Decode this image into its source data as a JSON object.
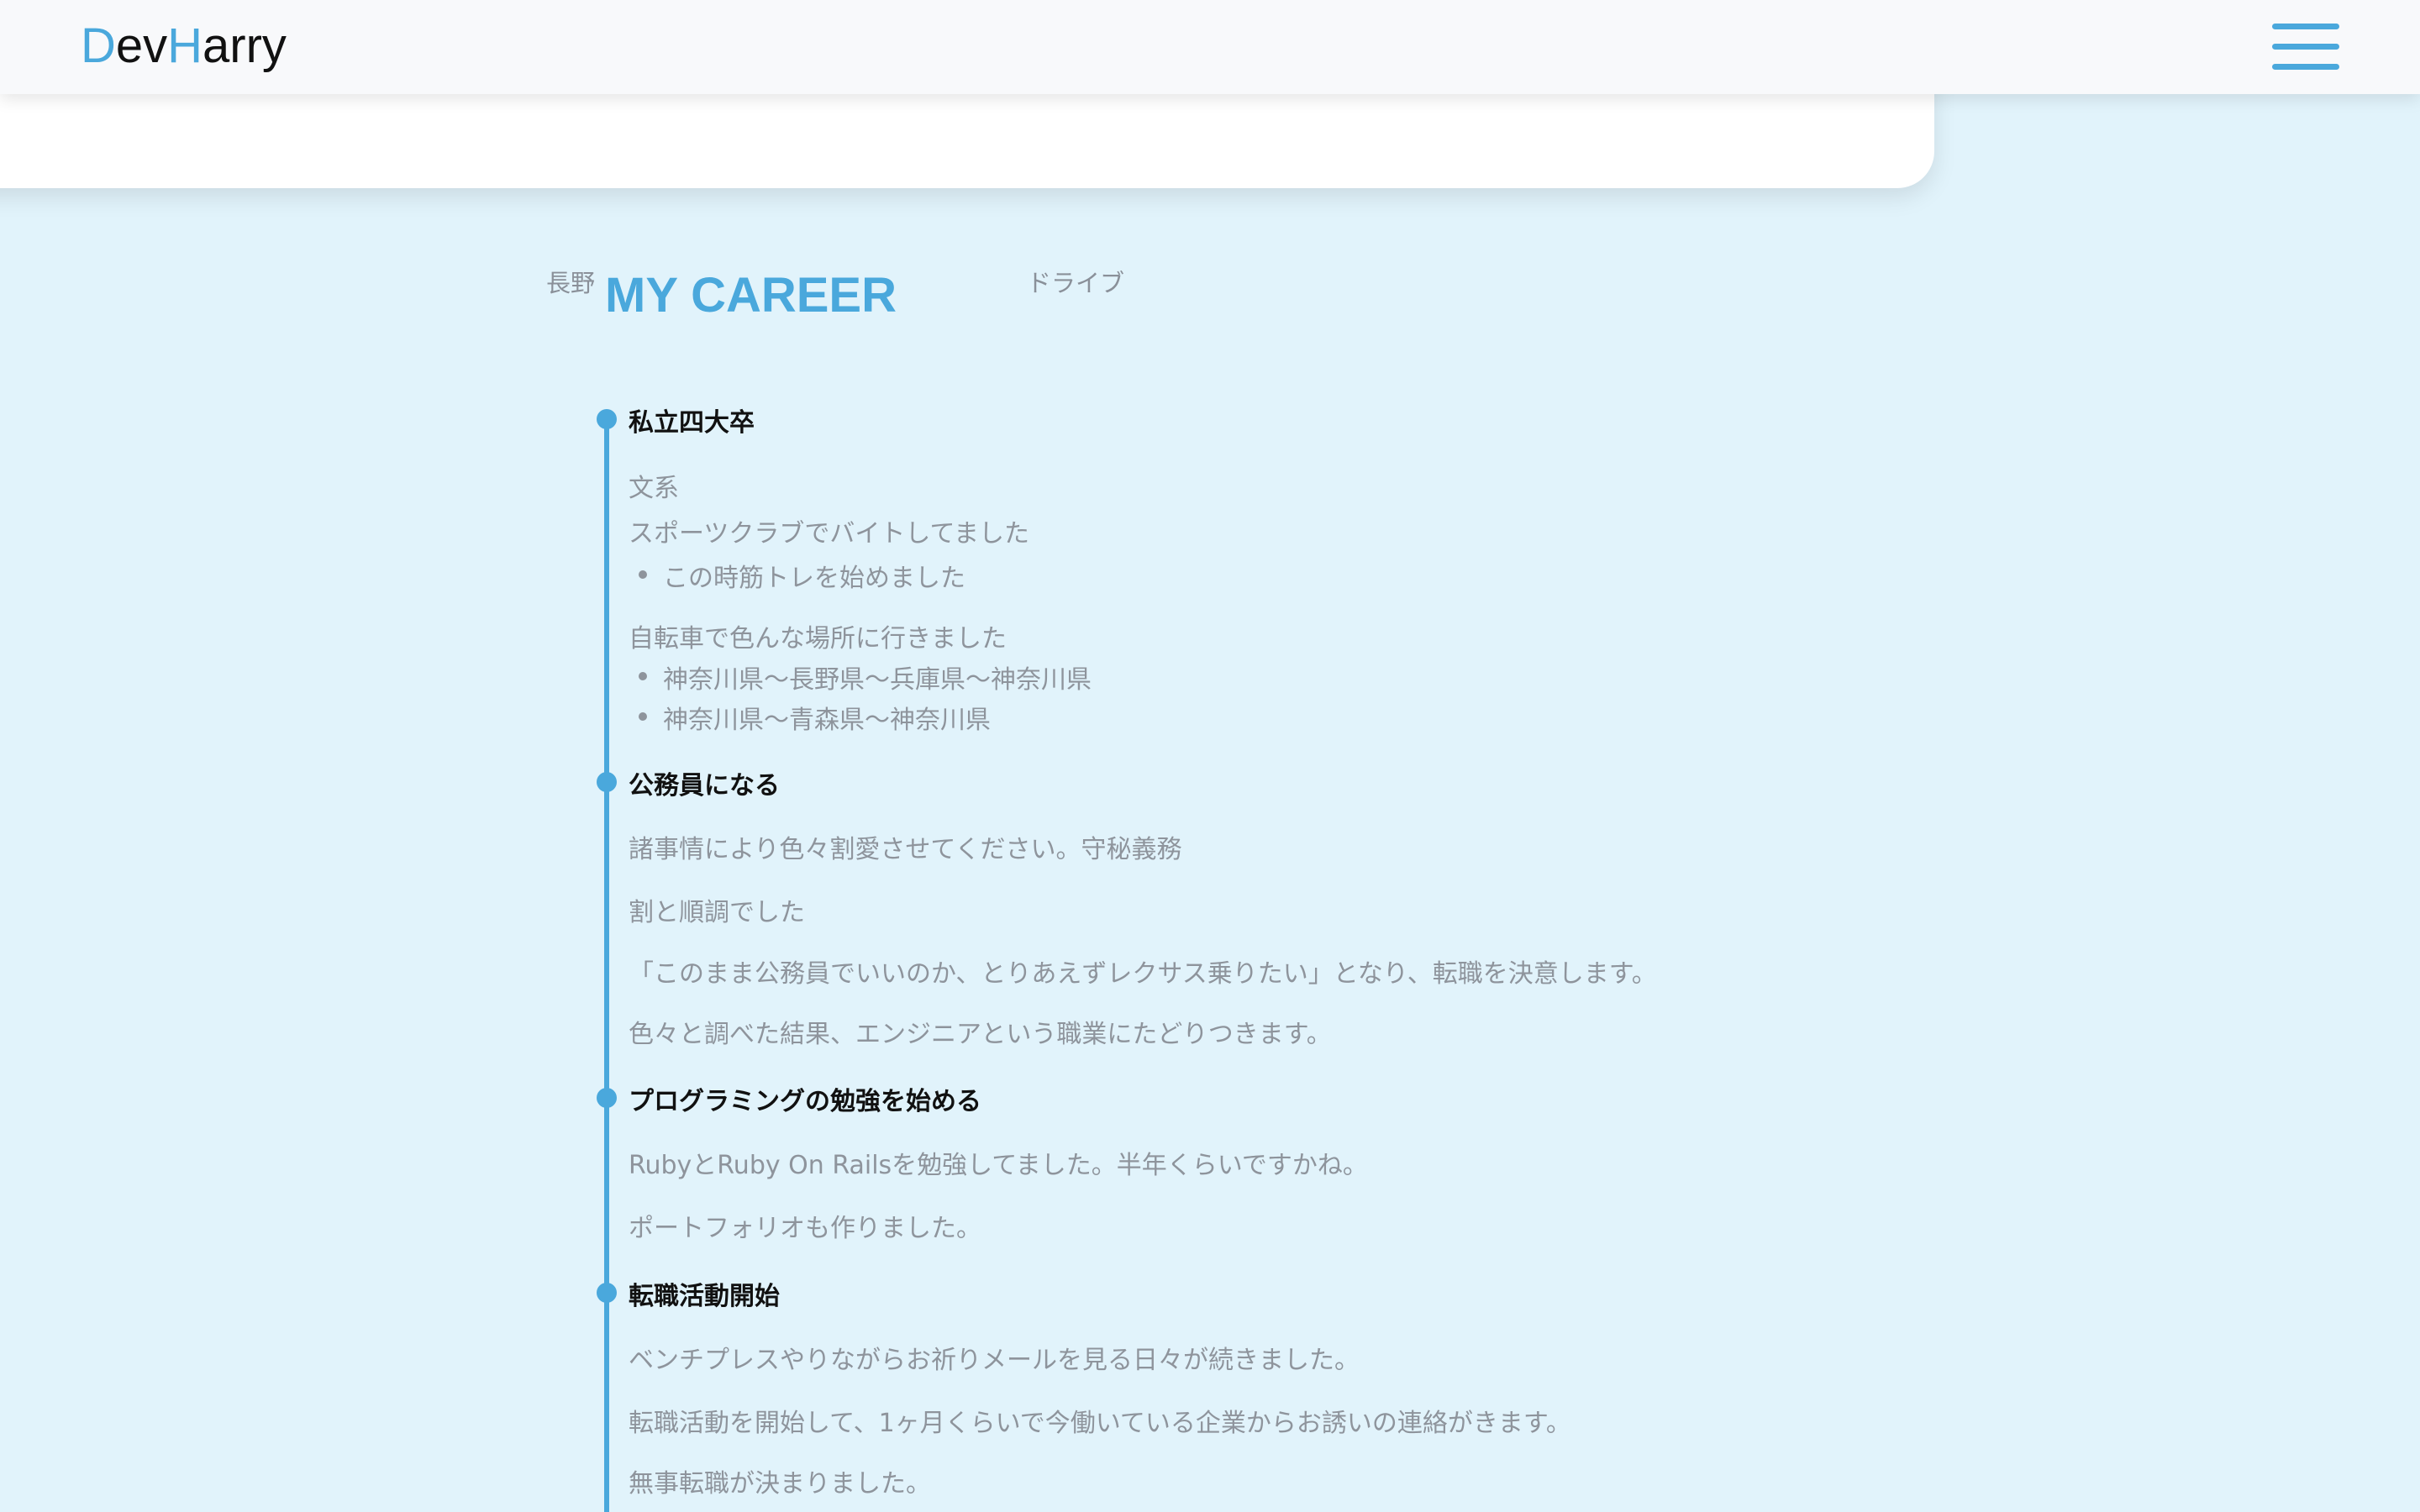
{
  "header": {
    "logo_d": "D",
    "logo_ev": "ev",
    "logo_h": "H",
    "logo_arry": "arry",
    "menu_icon": "hamburger-menu-icon"
  },
  "profile": {
    "hometown": "長野",
    "hobby": "ドライブ"
  },
  "career": {
    "title": "MY CAREER",
    "items": [
      {
        "heading": "私立四大卒",
        "lines": [
          "文系",
          "スポーツクラブでバイトしてました"
        ],
        "bullets1": [
          "この時筋トレを始めました"
        ],
        "line2": "自転車で色んな場所に行きました",
        "bullets2": [
          "神奈川県〜長野県〜兵庫県〜神奈川県",
          "神奈川県〜青森県〜神奈川県"
        ]
      },
      {
        "heading": "公務員になる",
        "lines": [
          "諸事情により色々割愛させてください。守秘義務",
          "割と順調でした",
          "「このまま公務員でいいのか、とりあえずレクサス乗りたい」となり、転職を決意します。",
          "色々と調べた結果、エンジニアという職業にたどりつきます。"
        ]
      },
      {
        "heading": "プログラミングの勉強を始める",
        "lines": [
          "RubyとRuby On Railsを勉強してました。半年くらいですかね。",
          "ポートフォリオも作りました。"
        ]
      },
      {
        "heading": "転職活動開始",
        "lines": [
          "ベンチプレスやりながらお祈りメールを見る日々が続きました。",
          "転職活動を開始して、1ヶ月くらいで今働いている企業からお誘いの連絡がきます。",
          "無事転職が決まりました。"
        ]
      }
    ]
  },
  "colors": {
    "accent": "#4aa8dc",
    "background": "#e1f3fb",
    "muted_text": "#8e949c"
  }
}
